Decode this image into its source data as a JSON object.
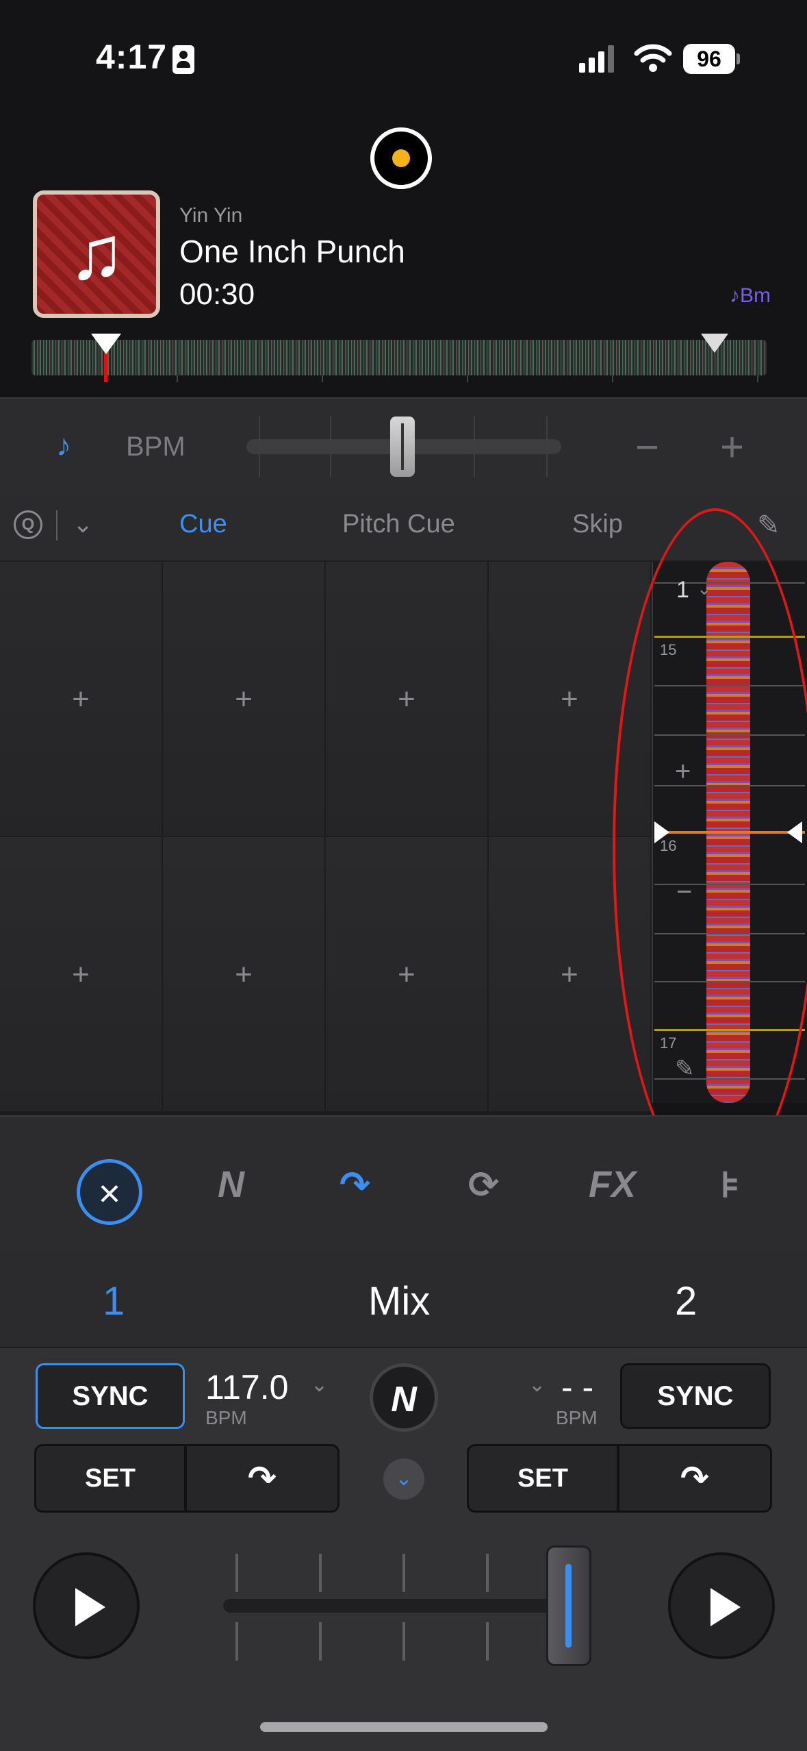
{
  "status_bar": {
    "time": "4:17",
    "battery": "96"
  },
  "track": {
    "artist": "Yin Yin",
    "title": "One Inch Punch",
    "time": "00:30",
    "key": "♪Bm"
  },
  "tempo": {
    "label": "BPM",
    "minus": "−",
    "plus": "+"
  },
  "tabs": {
    "items": [
      "Cue",
      "Pitch Cue",
      "Skip"
    ],
    "active": "Cue",
    "quantize_icon": "Q"
  },
  "pads": {
    "rows": 2,
    "cols": 4,
    "empty_symbol": "+"
  },
  "waveform": {
    "deck": "1",
    "beat_numbers": [
      "15",
      "16",
      "17"
    ],
    "zoom_in": "+",
    "zoom_out": "−"
  },
  "modes": {
    "close": "×",
    "neural": "N",
    "skip_cue": "↷",
    "loop": "⟳",
    "fx": "FX",
    "mixer": "⊧"
  },
  "mixer": {
    "deck1_label": "1",
    "center_label": "Mix",
    "deck2_label": "2",
    "sync_label": "SYNC",
    "deck1_bpm": "117.0",
    "deck2_bpm": "- -",
    "bpm_unit": "BPM",
    "set_label": "SET",
    "skip_symbol": "↷",
    "center_badge": "N",
    "expand": "⌄",
    "crossfader_position": 1.0
  },
  "colors": {
    "accent": "#3a8ff0",
    "key": "#7b5cf0",
    "playhead": "#e30f0f",
    "deck_dot": "#f7b21b",
    "annotation": "#e01818"
  }
}
